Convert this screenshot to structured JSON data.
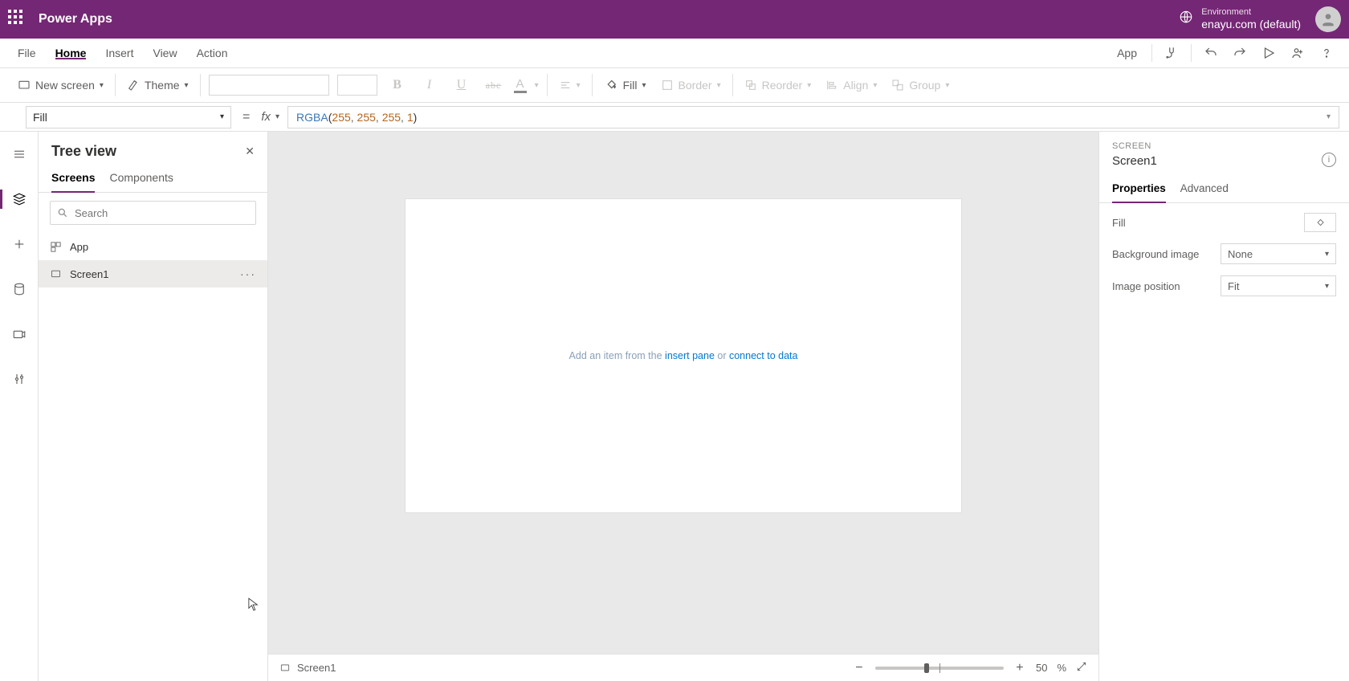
{
  "titlebar": {
    "app_title": "Power Apps",
    "env_label": "Environment",
    "env_name": "enayu.com (default)"
  },
  "menubar": {
    "items": [
      "File",
      "Home",
      "Insert",
      "View",
      "Action"
    ],
    "active_index": 1,
    "right": {
      "app_link": "App"
    }
  },
  "ribbon": {
    "new_screen": "New screen",
    "theme": "Theme",
    "fill": "Fill",
    "border": "Border",
    "reorder": "Reorder",
    "align": "Align",
    "group": "Group"
  },
  "formula": {
    "property": "Fill",
    "fx": "fx",
    "tokens": {
      "fn": "RGBA",
      "open": "(",
      "n1": "255",
      "c": ", ",
      "n2": "255",
      "n3": "255",
      "n4": "1",
      "close": ")"
    }
  },
  "tree": {
    "title": "Tree view",
    "tabs": {
      "screens": "Screens",
      "components": "Components"
    },
    "search_placeholder": "Search",
    "items": {
      "app": "App",
      "screen1": "Screen1"
    }
  },
  "canvas": {
    "placeholder_pre": "Add an item from the ",
    "placeholder_link1": "insert pane",
    "placeholder_mid": " or ",
    "placeholder_link2": "connect to data"
  },
  "canvas_footer": {
    "breadcrumb": "Screen1",
    "zoom_value": "50",
    "zoom_pct": "%"
  },
  "properties": {
    "type_label": "SCREEN",
    "name": "Screen1",
    "tabs": {
      "properties": "Properties",
      "advanced": "Advanced"
    },
    "rows": {
      "fill_label": "Fill",
      "bg_image_label": "Background image",
      "bg_image_value": "None",
      "img_pos_label": "Image position",
      "img_pos_value": "Fit"
    }
  }
}
